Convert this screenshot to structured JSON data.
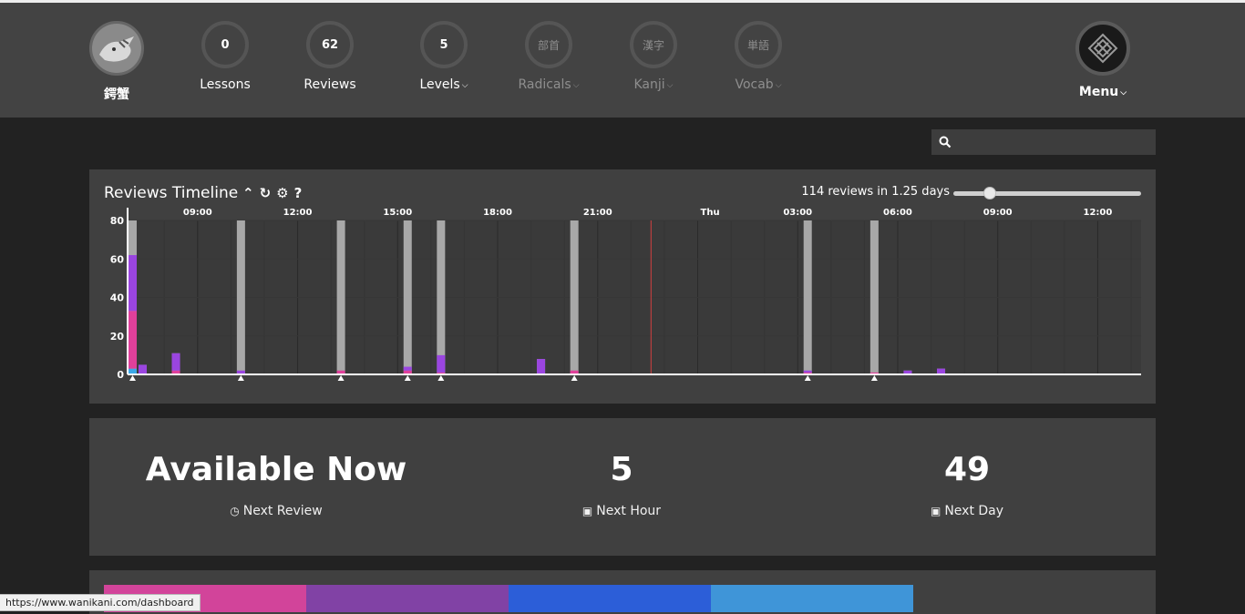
{
  "header": {
    "user": {
      "label": "鍔蟹"
    },
    "nav": [
      {
        "key": "lessons",
        "count": "0",
        "label": "Lessons"
      },
      {
        "key": "reviews",
        "count": "62",
        "label": "Reviews"
      },
      {
        "key": "levels",
        "count": "5",
        "label": "Levels"
      },
      {
        "key": "radicals",
        "glyph": "部首",
        "label": "Radicals"
      },
      {
        "key": "kanji",
        "glyph": "漢字",
        "label": "Kanji"
      },
      {
        "key": "vocab",
        "glyph": "単語",
        "label": "Vocab"
      }
    ],
    "menu_label": "Menu"
  },
  "search": {
    "placeholder": "",
    "value": ""
  },
  "timeline": {
    "title": "Reviews Timeline",
    "summary": "114 reviews in 1.25 days",
    "slider_fraction": 0.17,
    "colors": {
      "radical": "#e0409a",
      "kanji": "#9a45e0",
      "vocab": "#9a45e0",
      "burned": "#3ba8e8",
      "total": "#a8a8a8",
      "now_line": "#d44040"
    },
    "chart_data": {
      "type": "bar",
      "yticks": [
        0,
        20,
        40,
        60,
        80
      ],
      "ylim": [
        0,
        80
      ],
      "x_range_hours": [
        6.9,
        37.3
      ],
      "time_labels": [
        {
          "t": 9,
          "label": "09:00"
        },
        {
          "t": 12,
          "label": "12:00"
        },
        {
          "t": 15,
          "label": "15:00"
        },
        {
          "t": 18,
          "label": "18:00"
        },
        {
          "t": 21,
          "label": "21:00"
        },
        {
          "t": 24,
          "label": "Thu"
        },
        {
          "t": 27,
          "label": "03:00"
        },
        {
          "t": 30,
          "label": "06:00"
        },
        {
          "t": 33,
          "label": "09:00"
        },
        {
          "t": 36,
          "label": "12:00"
        }
      ],
      "now_hour": 22.6,
      "bars": [
        {
          "t": 7.05,
          "burned": 3,
          "radical": 30,
          "kanji": 29,
          "total": 80,
          "marker": true
        },
        {
          "t": 7.35,
          "burned": 0,
          "radical": 0,
          "kanji": 5,
          "total": 5,
          "marker": false
        },
        {
          "t": 8.35,
          "burned": 0,
          "radical": 2,
          "kanji": 9,
          "total": 11,
          "marker": false
        },
        {
          "t": 10.3,
          "burned": 0,
          "radical": 0,
          "kanji": 2,
          "total": 80,
          "marker": true
        },
        {
          "t": 13.3,
          "burned": 0,
          "radical": 2,
          "kanji": 0,
          "total": 80,
          "marker": true
        },
        {
          "t": 15.3,
          "burned": 0,
          "radical": 2,
          "kanji": 2,
          "total": 80,
          "marker": true
        },
        {
          "t": 16.3,
          "burned": 0,
          "radical": 1,
          "kanji": 9,
          "total": 80,
          "marker": true
        },
        {
          "t": 19.3,
          "burned": 0,
          "radical": 0,
          "kanji": 8,
          "total": 8,
          "marker": false
        },
        {
          "t": 20.3,
          "burned": 0,
          "radical": 2,
          "kanji": 0,
          "total": 80,
          "marker": true
        },
        {
          "t": 27.3,
          "burned": 0,
          "radical": 1,
          "kanji": 1,
          "total": 80,
          "marker": true
        },
        {
          "t": 29.3,
          "burned": 0,
          "radical": 1,
          "kanji": 0,
          "total": 80,
          "marker": true
        },
        {
          "t": 30.3,
          "burned": 0,
          "radical": 0,
          "kanji": 2,
          "total": 2,
          "marker": false
        },
        {
          "t": 31.3,
          "burned": 0,
          "radical": 0,
          "kanji": 3,
          "total": 3,
          "marker": false
        }
      ]
    }
  },
  "forecast": {
    "items": [
      {
        "value": "Available Now",
        "icon": "clock-icon",
        "label": "Next Review"
      },
      {
        "value": "5",
        "icon": "inbox-icon",
        "label": "Next Hour"
      },
      {
        "value": "49",
        "icon": "inbox-icon",
        "label": "Next Day"
      }
    ]
  },
  "srs_bar": {
    "colors": [
      "#d2449a",
      "#8142a5",
      "#2c5ed8",
      "#3f95d8"
    ],
    "fractions": [
      0.195,
      0.195,
      0.195,
      0.195
    ]
  },
  "statusbar": {
    "url": "https://www.wanikani.com/dashboard"
  }
}
